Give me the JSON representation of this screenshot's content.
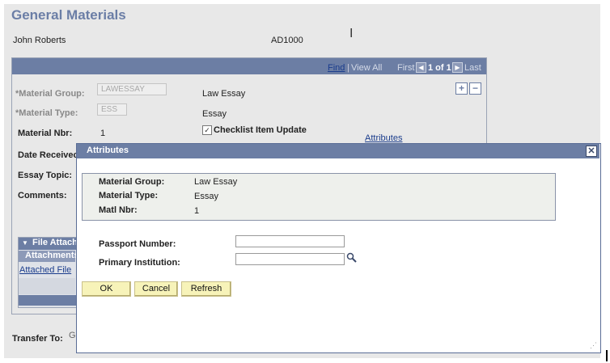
{
  "page": {
    "title": "General Materials",
    "person_name": "John Roberts",
    "person_id": "AD1000"
  },
  "grid_nav": {
    "find": "Find",
    "sep": "|",
    "view_all": "View All",
    "first": "First",
    "position": "1 of 1",
    "last": "Last"
  },
  "form": {
    "material_group_label": "*Material Group:",
    "material_group_value": "LAWESSAY",
    "material_group_desc": "Law Essay",
    "material_type_label": "*Material Type:",
    "material_type_value": "ESS",
    "material_type_desc": "Essay",
    "material_nbr_label": "Material Nbr:",
    "material_nbr_value": "1",
    "checklist_label": "Checklist Item Update",
    "attributes_link": "Attributes",
    "date_received_label": "Date Receivec",
    "essay_topic_label": "Essay Topic:",
    "comments_label": "Comments:",
    "transfer_label": "Transfer To:",
    "transfer_value": "G"
  },
  "attachments": {
    "header": "File Attachn",
    "sub_header": "Attachments",
    "column": "Attached File"
  },
  "modal": {
    "title": "Attributes",
    "material_group_label": "Material Group:",
    "material_group_value": "Law Essay",
    "material_type_label": "Material Type:",
    "material_type_value": "Essay",
    "matl_nbr_label": "Matl Nbr:",
    "matl_nbr_value": "1",
    "passport_label": "Passport Number:",
    "passport_value": "",
    "institution_label": "Primary Institution:",
    "institution_value": "",
    "ok": "OK",
    "cancel": "Cancel",
    "refresh": "Refresh"
  },
  "icons": {
    "close": "close-icon",
    "lookup": "magnifier-icon",
    "add_row": "plus-icon",
    "delete_row": "minus-icon",
    "collapse": "triangle-down-icon"
  },
  "colors": {
    "header_bar": "#6c7ea4",
    "title": "#6b7ea6",
    "button": "#f7f3b9",
    "link": "#1a3c8c"
  }
}
